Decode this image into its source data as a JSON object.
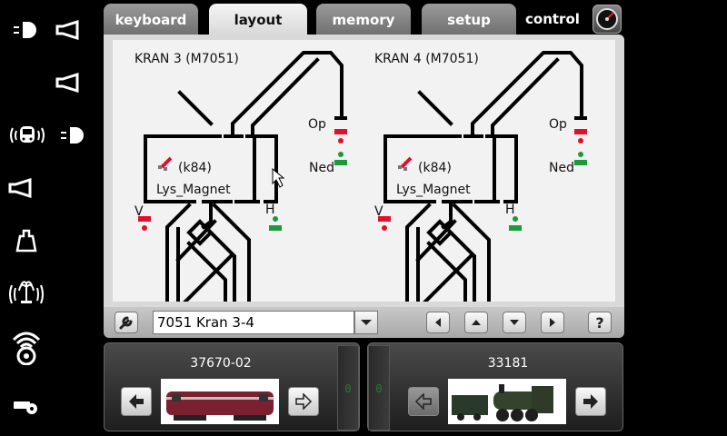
{
  "tabs": [
    {
      "label": "keyboard",
      "active": false
    },
    {
      "label": "layout",
      "active": true
    },
    {
      "label": "memory",
      "active": false
    },
    {
      "label": "setup",
      "active": false
    }
  ],
  "control": {
    "label": "control"
  },
  "left_functions": [
    "light-icon",
    "horn-icon",
    "horn-icon",
    "cab-radio-icon",
    "light-icon",
    "horn-icon",
    "weight-icon",
    "fountain-icon",
    "sound-icon",
    "whistle-icon"
  ],
  "layout": {
    "crane_left": {
      "title": "KRAN 3 (M7051)",
      "k": "(k84)",
      "magnet": "Lys_Magnet",
      "op": "Op",
      "ned": "Ned",
      "v": "V",
      "h": "H"
    },
    "crane_right": {
      "title": "KRAN 4 (M7051)",
      "k": "(k84)",
      "magnet": "Lys_Magnet",
      "op": "Op",
      "ned": "Ned",
      "v": "V",
      "h": "H"
    }
  },
  "toolbar": {
    "layout_name": "7051 Kran 3-4",
    "help": "?"
  },
  "locos": [
    {
      "address": "37670-02",
      "speed": "0",
      "image": "red-diesel-locomotive"
    },
    {
      "address": "33181",
      "speed": "0",
      "image": "green-steam-locomotive"
    }
  ],
  "colors": {
    "signal_red": "#e0102a",
    "signal_green": "#1a9a3a",
    "active_tab": "#e8e8e8"
  }
}
